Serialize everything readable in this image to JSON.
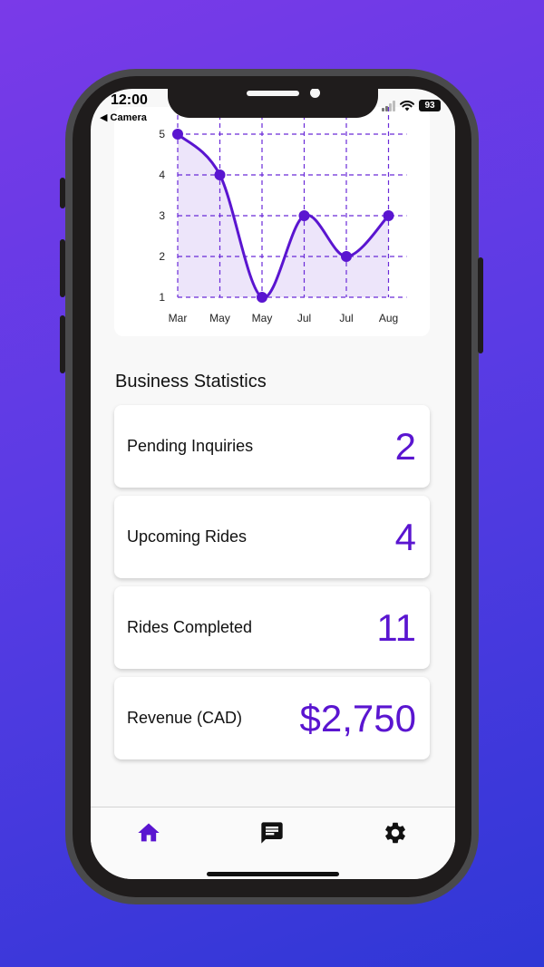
{
  "status_bar": {
    "time": "12:00",
    "back_label": "◀ Camera",
    "battery": "93"
  },
  "chart_data": {
    "type": "line",
    "categories": [
      "Mar",
      "May",
      "May",
      "Jul",
      "Jul",
      "Aug"
    ],
    "values": [
      5,
      4,
      1,
      3,
      2,
      3
    ],
    "y_ticks": [
      "1",
      "2",
      "3",
      "4",
      "5"
    ],
    "ylim": [
      1,
      5
    ],
    "grid": true,
    "line_color": "#5a15d0",
    "fill_color": "#ede5fa"
  },
  "business": {
    "title": "Business Statistics",
    "stats": [
      {
        "label": "Pending Inquiries",
        "value": "2"
      },
      {
        "label": "Upcoming Rides",
        "value": "4"
      },
      {
        "label": "Rides Completed",
        "value": "11"
      },
      {
        "label": "Revenue (CAD)",
        "value": "$2,750"
      }
    ]
  },
  "tabs": [
    {
      "icon": "home-icon",
      "active": true
    },
    {
      "icon": "message-icon",
      "active": false
    },
    {
      "icon": "settings-icon",
      "active": false
    }
  ],
  "colors": {
    "accent": "#5a15d0",
    "background_start": "#7a3ae8",
    "background_end": "#2f37d6"
  }
}
